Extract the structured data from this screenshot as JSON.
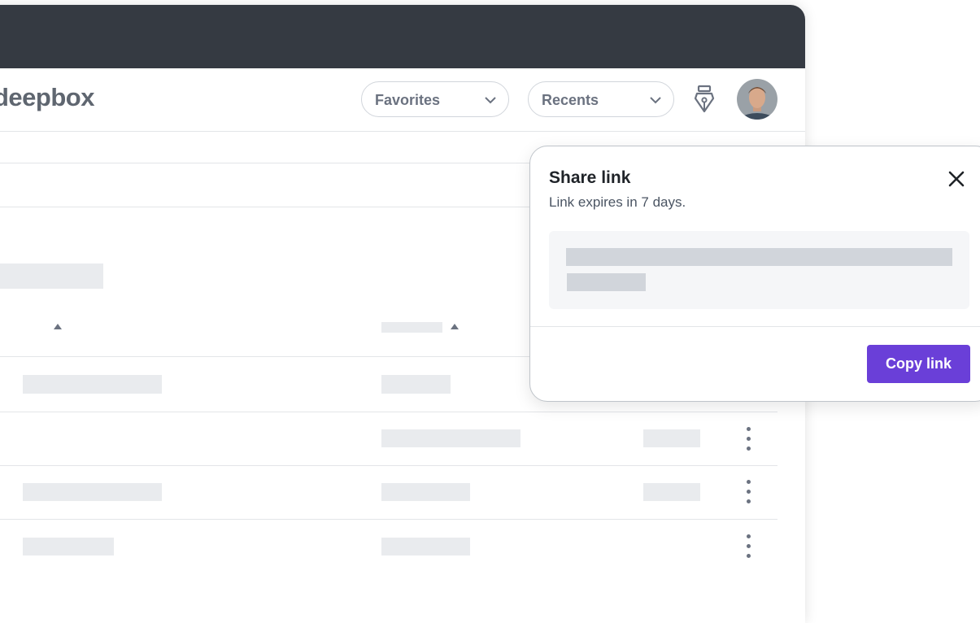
{
  "app": {
    "logo_text": "deepbox"
  },
  "header": {
    "favorites_label": "Favorites",
    "recents_label": "Recents",
    "pen_icon": "fountain-pen-icon",
    "avatar_icon": "user-avatar"
  },
  "table": {
    "sort_icon": "sort-ascending-icon",
    "row_menu_icon": "more-vertical-icon"
  },
  "share_popup": {
    "title": "Share link",
    "subtitle": "Link expires in 7 days.",
    "copy_label": "Copy link",
    "close_icon": "close-icon"
  },
  "colors": {
    "titlebar": "#353a42",
    "accent": "#6a3fd8",
    "placeholder": "#e9ebee"
  }
}
